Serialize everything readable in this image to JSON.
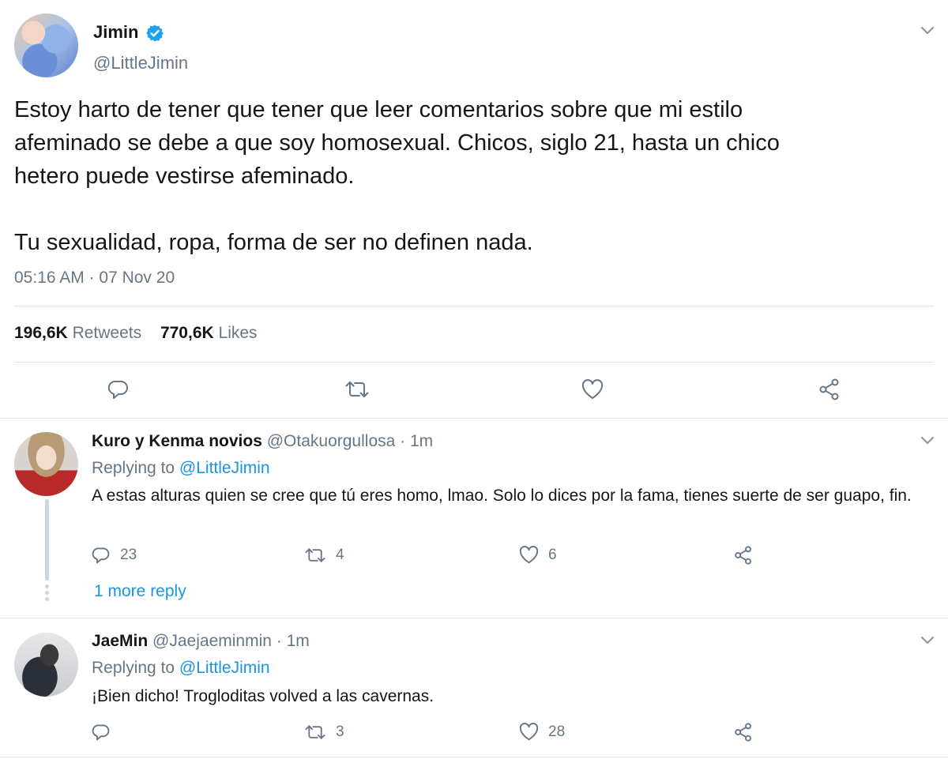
{
  "main_tweet": {
    "name": "Jimin",
    "handle": "@LittleJimin",
    "text": "Estoy harto de tener que tener que leer comentarios sobre que mi estilo\nafeminado se debe a que soy homosexual. Chicos, siglo 21, hasta un chico\nhetero puede vestirse afeminado.\n\nTu sexualidad, ropa, forma de ser no definen nada.",
    "timestamp": "05:16 AM · 07 Nov 20",
    "retweets_count": "196,6K",
    "retweets_label": "Retweets",
    "likes_count": "770,6K",
    "likes_label": "Likes"
  },
  "replies": [
    {
      "name": "Kuro y Kenma novios",
      "handle": "@Otakuorgullosa",
      "time": "· 1m",
      "replying_prefix": "Replying to",
      "replying_to": "@LittleJimin",
      "text": "A estas alturas quien se cree que tú  eres homo, lmao. Solo lo dices por la fama, tienes suerte de ser guapo, fin.",
      "reply_count": "23",
      "retweet_count": "4",
      "like_count": "6",
      "more_replies": "1 more reply"
    },
    {
      "name": "JaeMin",
      "handle": "@Jaejaeminmin",
      "time": "· 1m",
      "replying_prefix": "Replying to",
      "replying_to": "@LittleJimin",
      "text": "¡Bien dicho! Trogloditas volved a las cavernas.",
      "reply_count": "",
      "retweet_count": "3",
      "like_count": "28"
    }
  ],
  "colors": {
    "text": "#14171a",
    "muted": "#657786",
    "link": "#1b95e0",
    "verified": "#1da1f2",
    "divider": "#e1e8ed"
  },
  "icons": [
    "verified-badge-icon",
    "chevron-down-icon",
    "reply-icon",
    "retweet-icon",
    "like-icon",
    "share-icon"
  ]
}
